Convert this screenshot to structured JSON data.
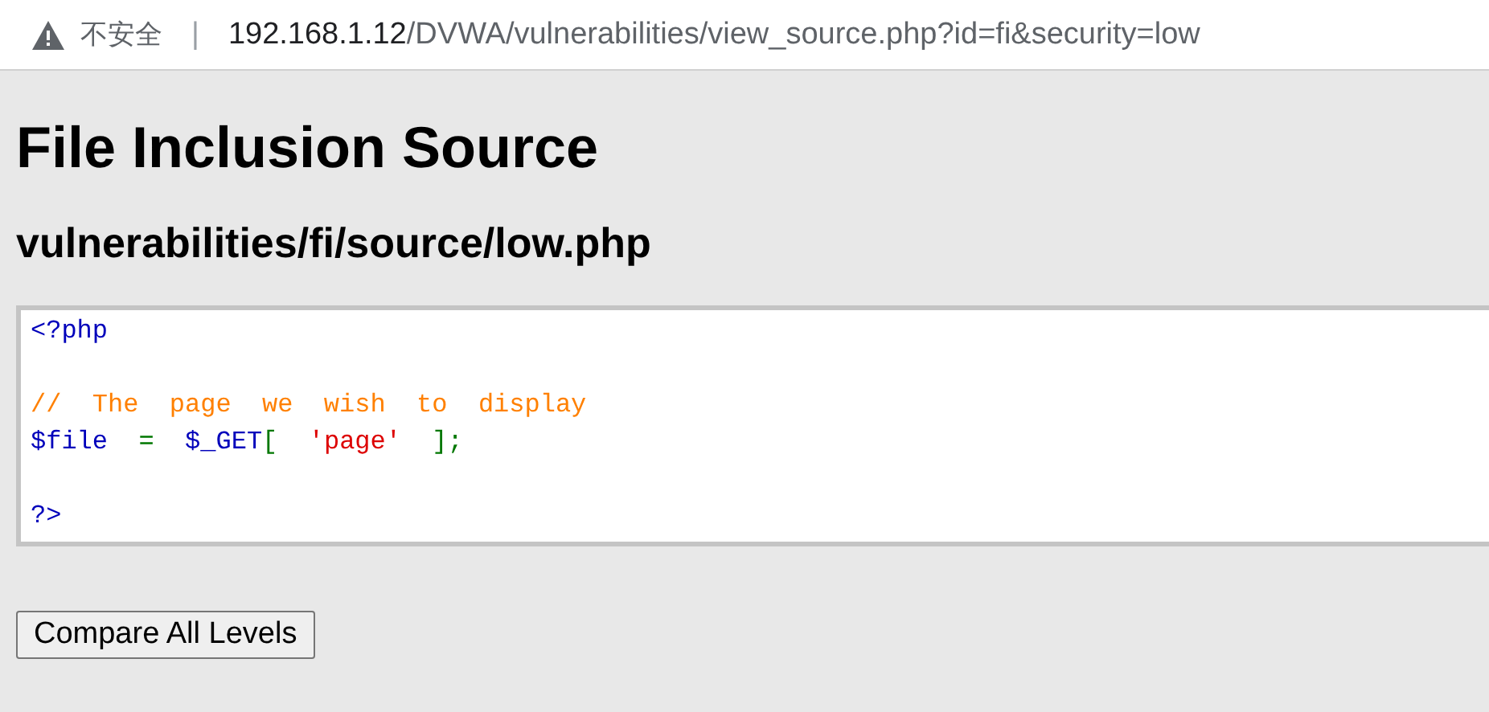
{
  "address_bar": {
    "security_label": "不安全",
    "separator": "|",
    "url_host": "192.168.1.12",
    "url_path": "/DVWA/vulnerabilities/view_source.php?id=fi&security=low"
  },
  "title": "File Inclusion Source",
  "subtitle": "vulnerabilities/fi/source/low.php",
  "code_blocks": [
    {
      "lines": [
        [
          {
            "kind": "tag",
            "text": "<?php"
          }
        ]
      ]
    },
    {
      "lines": [
        [
          {
            "kind": "comment",
            "text": "//  The  page  we  wish  to  display"
          }
        ],
        [
          {
            "kind": "variable",
            "text": "$file  "
          },
          {
            "kind": "operator",
            "text": "=  "
          },
          {
            "kind": "variable",
            "text": "$_GET"
          },
          {
            "kind": "operator",
            "text": "[  "
          },
          {
            "kind": "string",
            "text": "'page'"
          },
          {
            "kind": "operator",
            "text": "  ];"
          }
        ]
      ]
    },
    {
      "lines": [
        [
          {
            "kind": "tag",
            "text": "?>"
          }
        ]
      ]
    }
  ],
  "buttons": [
    "Compare All Levels"
  ]
}
